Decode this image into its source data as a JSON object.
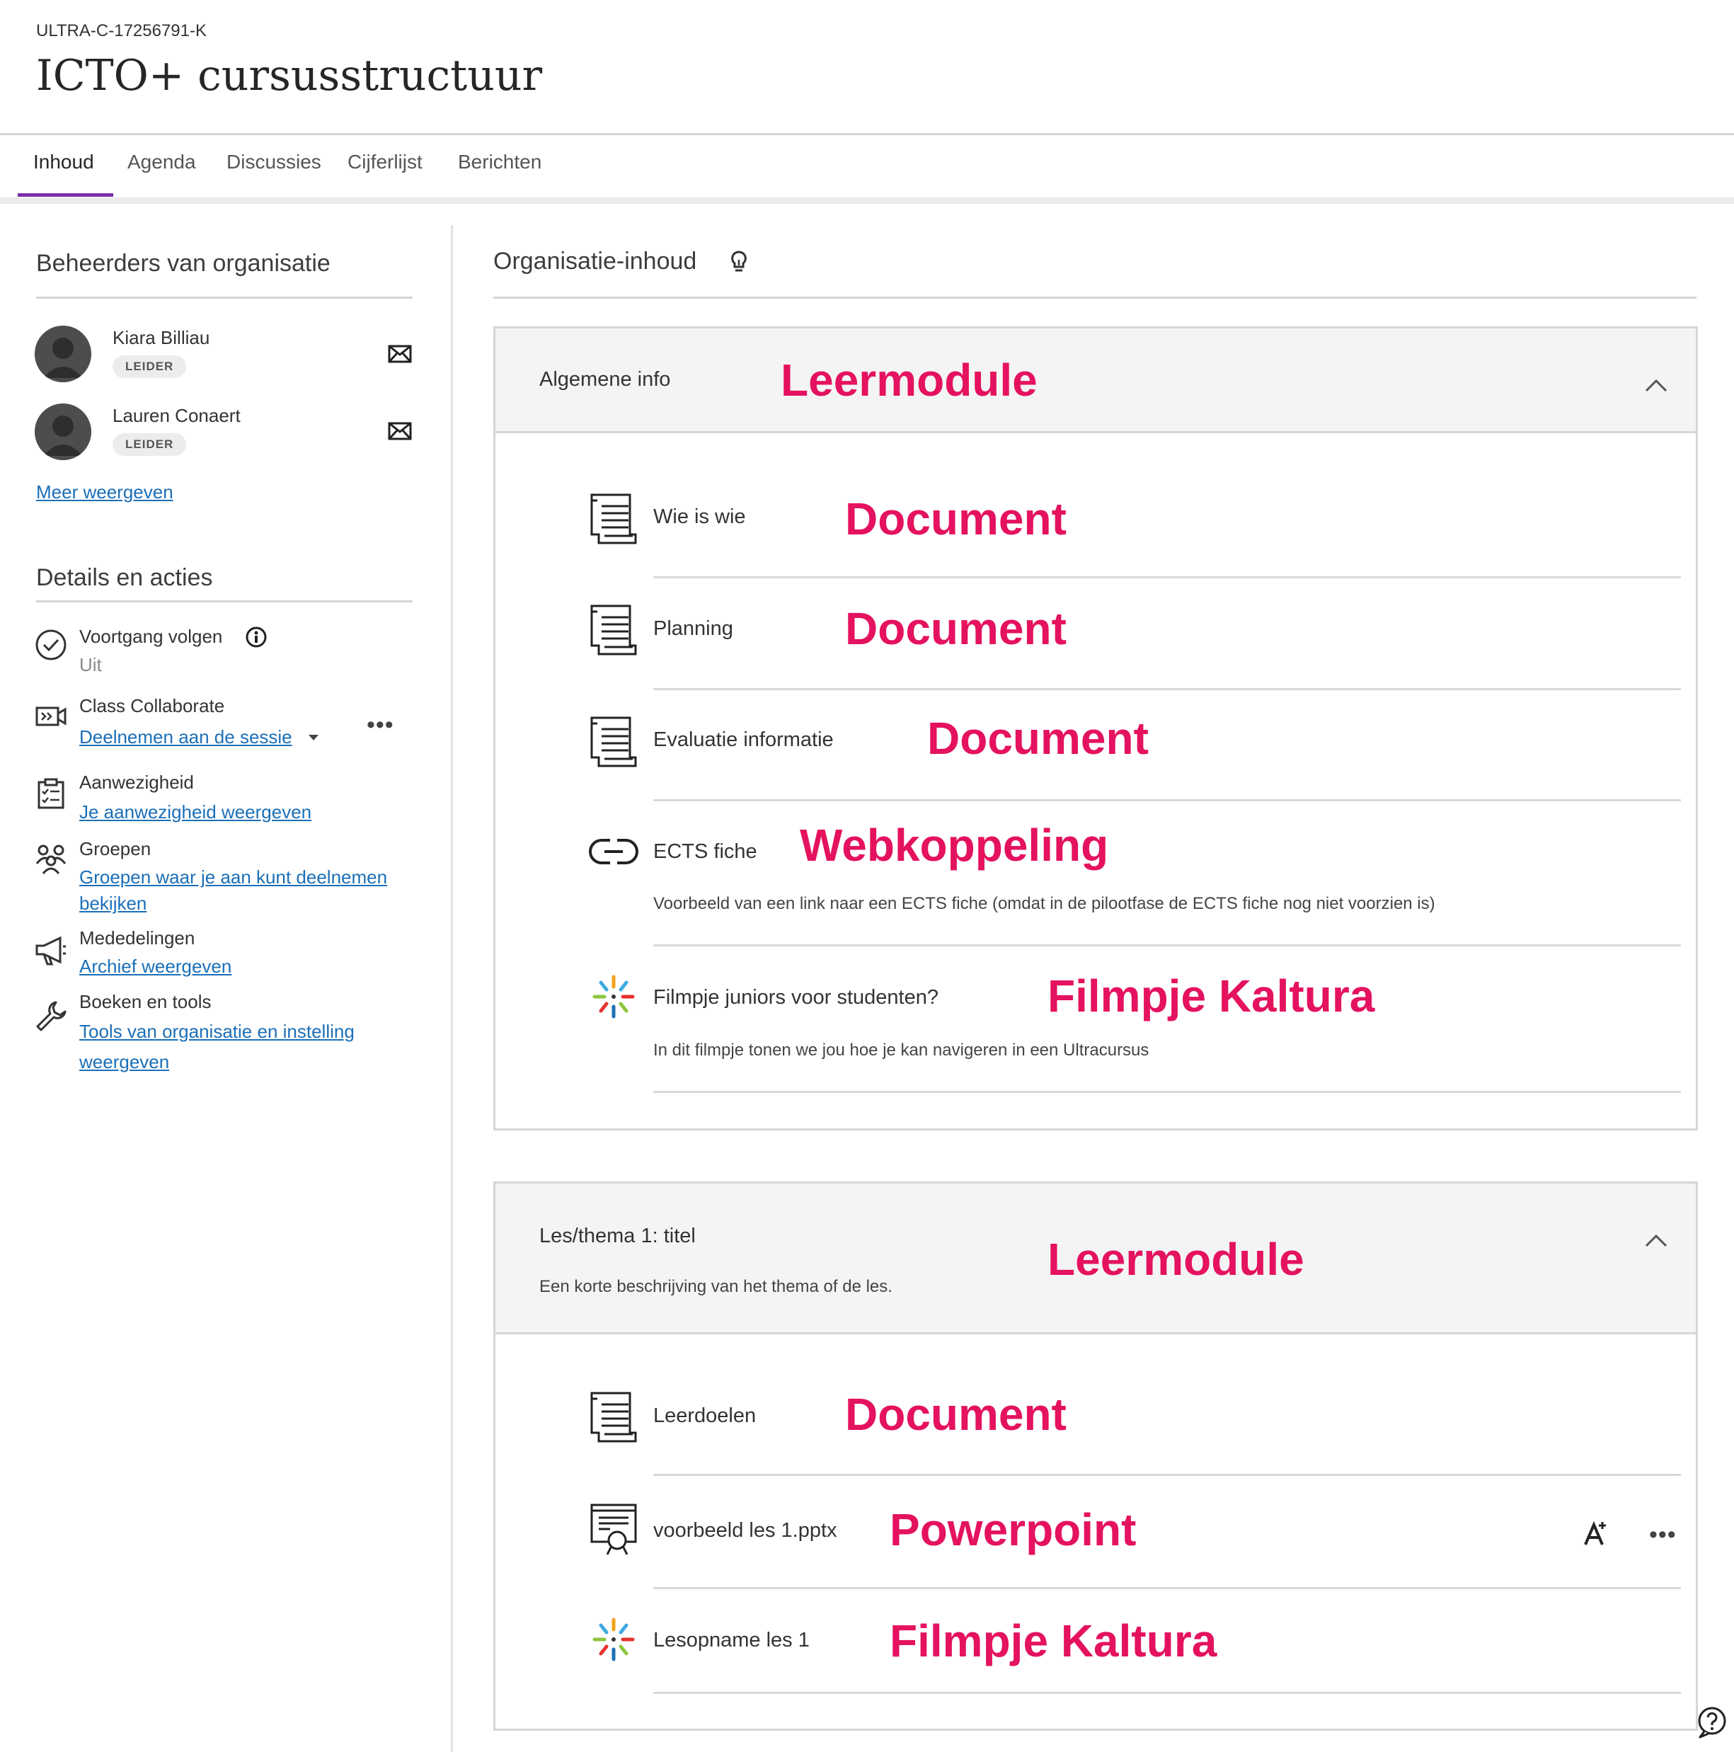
{
  "course": {
    "id": "ULTRA-C-17256791-K",
    "title": "ICTO+ cursusstructuur"
  },
  "tabs": [
    {
      "label": "Inhoud",
      "active": true
    },
    {
      "label": "Agenda"
    },
    {
      "label": "Discussies"
    },
    {
      "label": "Cijferlijst"
    },
    {
      "label": "Berichten"
    }
  ],
  "sidebar": {
    "managers_heading": "Beheerders van organisatie",
    "managers": [
      {
        "name": "Kiara Billiau",
        "role": "LEIDER"
      },
      {
        "name": "Lauren Conaert",
        "role": "LEIDER"
      }
    ],
    "more_link": "Meer weergeven",
    "details_heading": "Details en acties",
    "details": {
      "progress": {
        "title": "Voortgang volgen",
        "value": "Uit"
      },
      "collaborate": {
        "title": "Class Collaborate",
        "link": "Deelnemen aan de sessie"
      },
      "attendance": {
        "title": "Aanwezigheid",
        "link": "Je aanwezigheid weergeven"
      },
      "groups": {
        "title": "Groepen",
        "link_line1": "Groepen waar je aan kunt deelnemen",
        "link_line2": "bekijken"
      },
      "announcements": {
        "title": "Mededelingen",
        "link": "Archief weergeven"
      },
      "tools": {
        "title": "Boeken en tools",
        "link_line1": "Tools van organisatie en instelling",
        "link_line2": "weergeven"
      }
    }
  },
  "main": {
    "heading": "Organisatie-inhoud",
    "modules": [
      {
        "title": "Algemene info",
        "annotation": "Leermodule",
        "items": [
          {
            "title": "Wie is wie",
            "icon": "document-icon",
            "annotation": "Document"
          },
          {
            "title": "Planning",
            "icon": "document-icon",
            "annotation": "Document"
          },
          {
            "title": "Evaluatie informatie",
            "icon": "document-icon",
            "annotation": "Document"
          },
          {
            "title": "ECTS fiche",
            "icon": "link-icon",
            "annotation": "Webkoppeling",
            "description": "Voorbeeld van een link naar een ECTS fiche (omdat in de pilootfase de ECTS fiche nog niet voorzien is)"
          },
          {
            "title": "Filmpje juniors voor studenten?",
            "icon": "kaltura-icon",
            "annotation": "Filmpje Kaltura",
            "description": "In dit filmpje tonen we jou hoe je kan navigeren in een Ultracursus"
          }
        ]
      },
      {
        "title": "Les/thema 1: titel",
        "description": "Een korte beschrijving van het thema of de les.",
        "annotation": "Leermodule",
        "items": [
          {
            "title": "Leerdoelen",
            "icon": "document-icon",
            "annotation": "Document"
          },
          {
            "title": "voorbeeld les 1.pptx",
            "icon": "presentation-icon",
            "annotation": "Powerpoint"
          },
          {
            "title": "Lesopname les 1",
            "icon": "kaltura-icon",
            "annotation": "Filmpje Kaltura"
          }
        ]
      }
    ]
  },
  "colors": {
    "accent": "#7d2ea9",
    "annotation": "#e4125f",
    "link": "#1b6fb8"
  }
}
